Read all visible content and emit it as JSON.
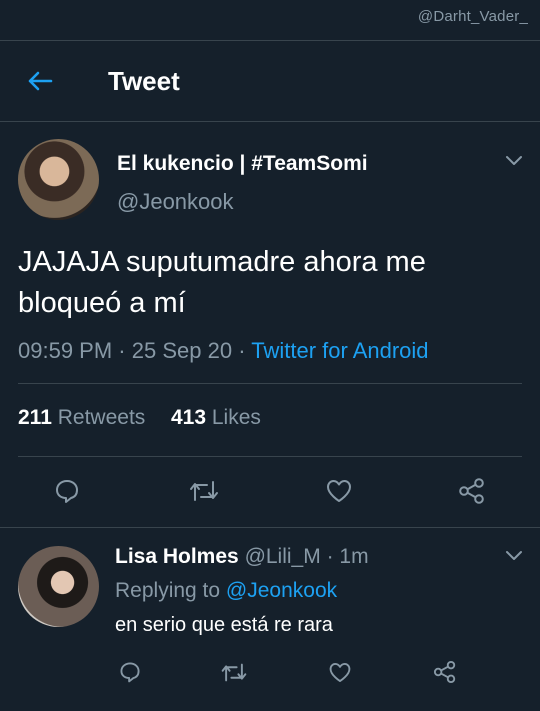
{
  "watermark": "@Darht_Vader_",
  "header": {
    "title": "Tweet"
  },
  "tweet": {
    "author_name": "El kukencio | #TeamSomi",
    "author_handle": "@Jeonkook",
    "text": "JAJAJA suputumadre ahora me bloqueó a mí",
    "time": "09:59 PM",
    "date": "25 Sep 20",
    "source": "Twitter for Android",
    "retweets_count": "211",
    "retweets_label": "Retweets",
    "likes_count": "413",
    "likes_label": "Likes"
  },
  "reply": {
    "author_name": "Lisa Holmes",
    "author_handle": "@Lili_M",
    "time_ago": "1m",
    "replying_label": "Replying to",
    "replying_to": "@Jeonkook",
    "text": "en serio que está re rara"
  },
  "colors": {
    "background": "#15202b",
    "accent": "#1da1f2",
    "secondary_text": "#8899a6",
    "divider": "#38444d"
  },
  "icons": [
    "back-arrow-icon",
    "chevron-down-icon",
    "reply-icon",
    "retweet-icon",
    "like-icon",
    "share-icon"
  ]
}
